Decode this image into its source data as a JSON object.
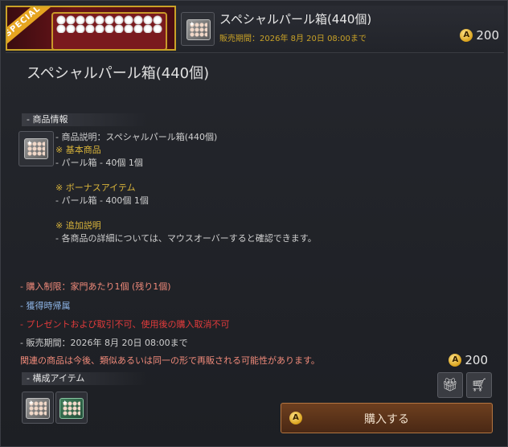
{
  "banner": {
    "ribbon": "SPECIAL",
    "title": "スペシャルパール箱(440個)",
    "sale_period": "販売期間：2026年 8月 20日 08:00まで",
    "price": "200",
    "currency_icon": "acoin-icon"
  },
  "main_title": "スペシャルパール箱(440個)",
  "sections": {
    "product_info": "- 商品情報",
    "components": "- 構成アイテム"
  },
  "description": [
    {
      "text": "- 商品説明：スペシャルパール箱(440個)",
      "color": "#cfcfcf"
    },
    {
      "text": "※ 基本商品",
      "color": "#d9b43a"
    },
    {
      "text": "- パール箱 - 40個 1個",
      "color": "#cfcfcf"
    },
    {
      "text": "※ ボーナスアイテム",
      "color": "#d9b43a"
    },
    {
      "text": "- パール箱 - 400個 1個",
      "color": "#cfcfcf"
    },
    {
      "text": "※ 追加説明",
      "color": "#d9b43a"
    },
    {
      "text": "- 各商品の詳細については、マウスオーバーすると確認できます。",
      "color": "#cfcfcf"
    }
  ],
  "notes": [
    {
      "text": "- 購入制限：家門あたり1個 (残り1個)",
      "color": "#f08a7a"
    },
    {
      "text": "- 獲得時帰属",
      "color": "#8db4e6"
    },
    {
      "text": "- プレゼントおよび取引不可、使用後の購入取消不可",
      "color": "#e23b3b"
    },
    {
      "text": "- 販売期間：2026年 8月 20日 08:00まで",
      "color": "#cfcfcf"
    },
    {
      "text": "関連の商品は今後、類似あるいは同一の形で再販される可能性があります。",
      "color": "#f08a7a"
    }
  ],
  "price_bottom": "200",
  "actions": {
    "gift_icon": "gift-icon",
    "cart_icon": "cart-icon",
    "buy_label": "購入する"
  }
}
